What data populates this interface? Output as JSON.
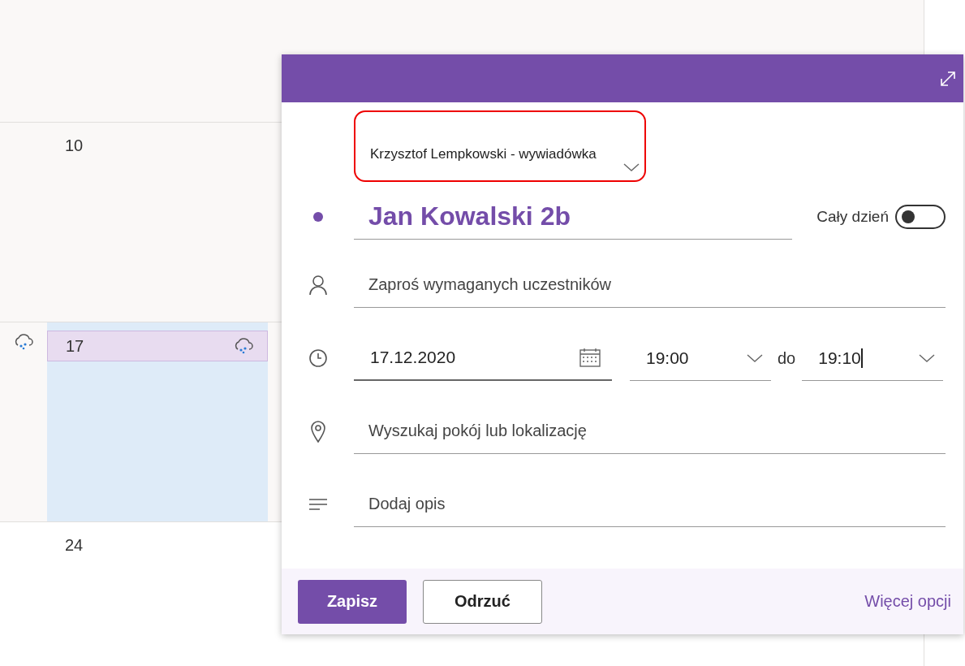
{
  "calendar": {
    "weeks": [
      {
        "day": "10",
        "selected": false,
        "weather": false
      },
      {
        "day": "17",
        "selected": true,
        "weather": true
      },
      {
        "day": "24",
        "selected": false,
        "weather": false
      }
    ]
  },
  "event_form": {
    "calendar_select": {
      "value": "Krzysztof Lempkowski - wywiadówka",
      "highlighted": true
    },
    "title": {
      "value": "Jan Kowalski 2b"
    },
    "all_day": {
      "label": "Cały dzień",
      "on": false
    },
    "attendees": {
      "placeholder": "Zaproś wymaganych uczestników"
    },
    "date": {
      "value": "17.12.2020"
    },
    "start_time": {
      "value": "19:00"
    },
    "range_label": "do",
    "end_time": {
      "value": "19:10",
      "focused": true
    },
    "location": {
      "placeholder": "Wyszukaj pokój lub lokalizację"
    },
    "description": {
      "placeholder": "Dodaj opis"
    },
    "buttons": [
      {
        "label": "Zapisz",
        "kind": "primary"
      },
      {
        "label": "Odrzuć",
        "kind": "secondary"
      }
    ],
    "more_options": "Więcej opcji"
  }
}
